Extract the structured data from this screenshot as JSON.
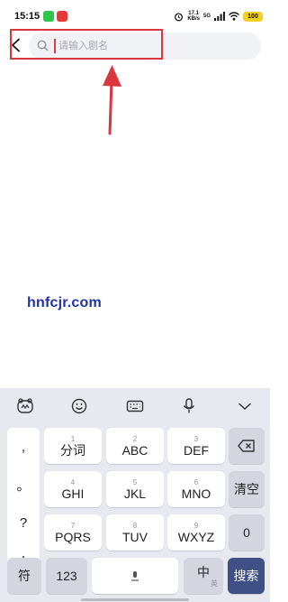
{
  "status_bar": {
    "time": "15:15",
    "net_speed_value": "17.1",
    "net_speed_unit": "KB/s",
    "network": "5G",
    "battery": "100"
  },
  "search": {
    "placeholder": "请输入剧名",
    "value": ""
  },
  "watermark": "hnfcjr.com",
  "keyboard": {
    "punctuation": [
      ",",
      "。",
      "?",
      "!"
    ],
    "keys": [
      {
        "num": "1",
        "label": "分词"
      },
      {
        "num": "2",
        "label": "ABC"
      },
      {
        "num": "3",
        "label": "DEF"
      },
      {
        "num": "4",
        "label": "GHI"
      },
      {
        "num": "5",
        "label": "JKL"
      },
      {
        "num": "6",
        "label": "MNO"
      },
      {
        "num": "7",
        "label": "PQRS"
      },
      {
        "num": "8",
        "label": "TUV"
      },
      {
        "num": "9",
        "label": "WXYZ"
      }
    ],
    "clear_label": "清空",
    "zero_label": "0",
    "symbols_label": "符",
    "numbers_label": "123",
    "lang_label": "中",
    "lang_sub": "英",
    "search_label": "搜索"
  },
  "colors": {
    "annotation": "#d9363e",
    "search_key": "#3f5086",
    "watermark": "#2132a8"
  }
}
